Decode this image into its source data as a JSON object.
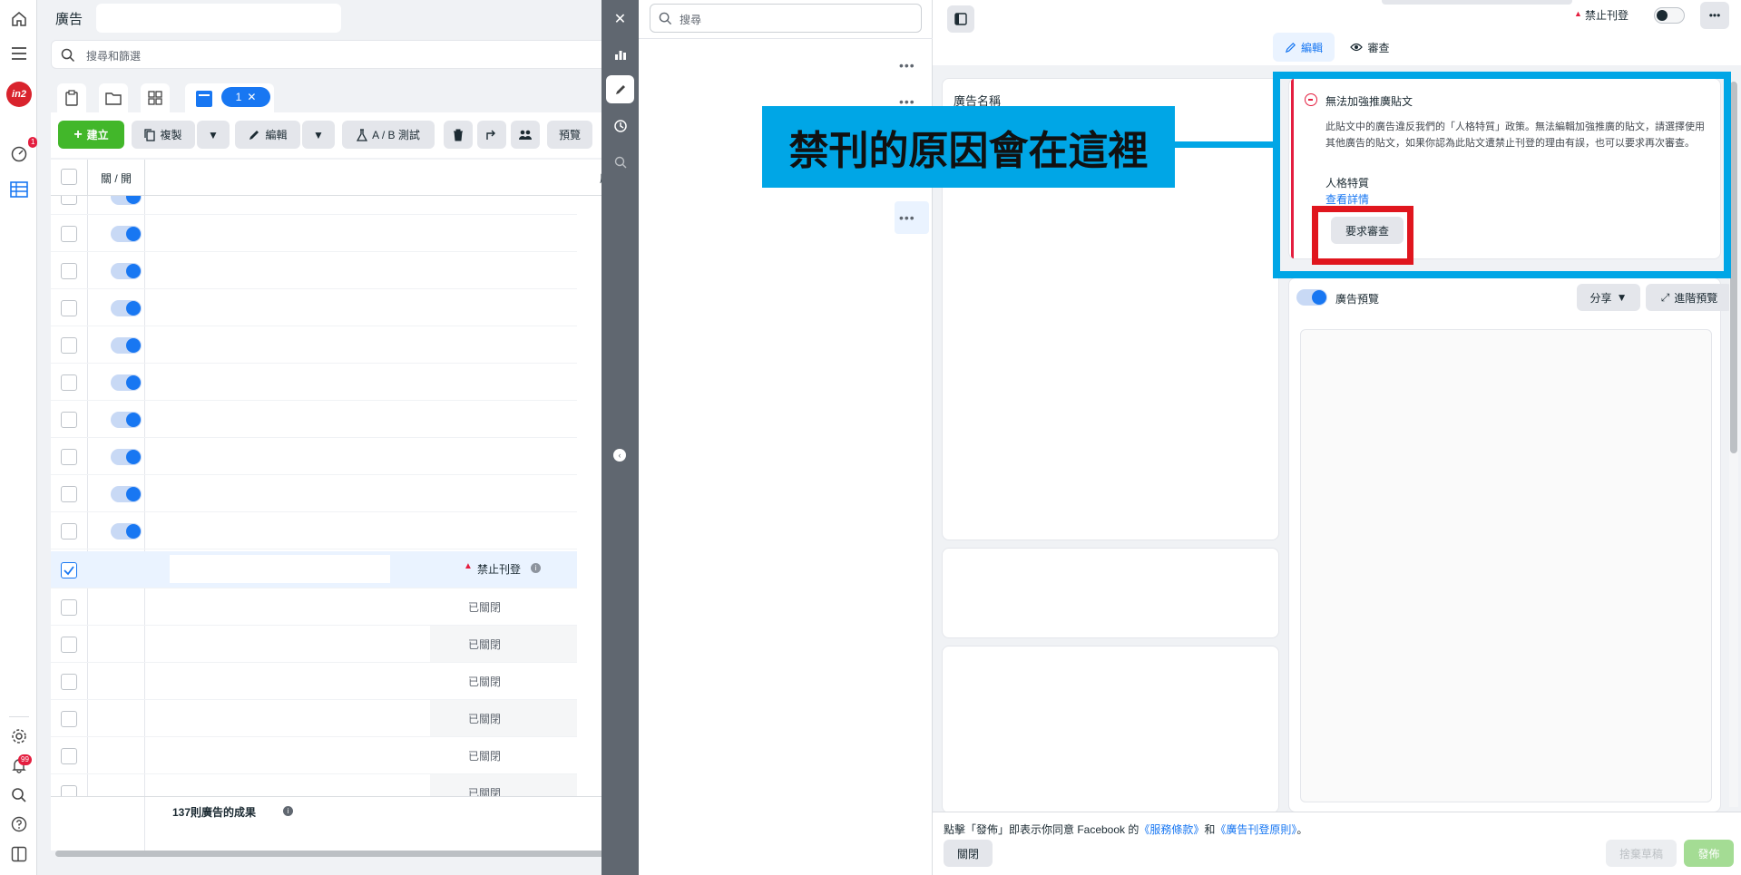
{
  "left_panel": {
    "title": "廣告",
    "search_placeholder": "搜尋和篩選",
    "selected_tab_count": "1",
    "toolbar": {
      "create_label": "建立",
      "duplicate_label": "複製",
      "edit_label": "編輯",
      "ab_test_label": "A / B 測試",
      "preview_label": "預覽"
    },
    "table": {
      "header_toggle": "關 / 開",
      "header_name_partial": "廣",
      "selected_row_status": "禁止刊登",
      "off_status_label": "已關閉",
      "footer_results": "137則廣告的成果"
    }
  },
  "nav": {
    "notifications_count": "1",
    "alerts_count": "99",
    "brand_text": "in2"
  },
  "middle_panel": {
    "search_placeholder": "搜尋"
  },
  "right_panel": {
    "status_label": "禁止刊登",
    "tab_edit": "編輯",
    "tab_review": "審查",
    "ad_name_label": "廣告名稱",
    "alert": {
      "title": "無法加強推廣貼文",
      "body": "此貼文中的廣告違反我們的「人格特質」政策。無法編輯加強推廣的貼文，請選擇使用其他廣告的貼文，如果你認為此貼文遭禁止刊登的理由有誤，也可以要求再次審查。",
      "policy_name": "人格特質",
      "details_link": "查看詳情",
      "request_review_button": "要求審查"
    },
    "preview": {
      "label": "廣告預覽",
      "share_button": "分享",
      "advanced_preview_button": "進階預覽"
    },
    "footer": {
      "terms_prefix": "點擊「發佈」即表示你同意 Facebook 的",
      "terms_link": "《服務條款》",
      "and": "和",
      "policies_link": "《廣告刊登原則》",
      "suffix": "。",
      "close_button": "關閉",
      "discard_button": "捨棄草稿",
      "publish_button": "發佈"
    }
  },
  "annotation": {
    "callout_text": "禁刊的原因會在這裡"
  },
  "colors": {
    "brand_blue": "#1877f2",
    "create_green": "#42b72a",
    "callout_blue": "#00a6e6",
    "highlight_red": "#e0161e",
    "error_red": "#e41e3f"
  }
}
